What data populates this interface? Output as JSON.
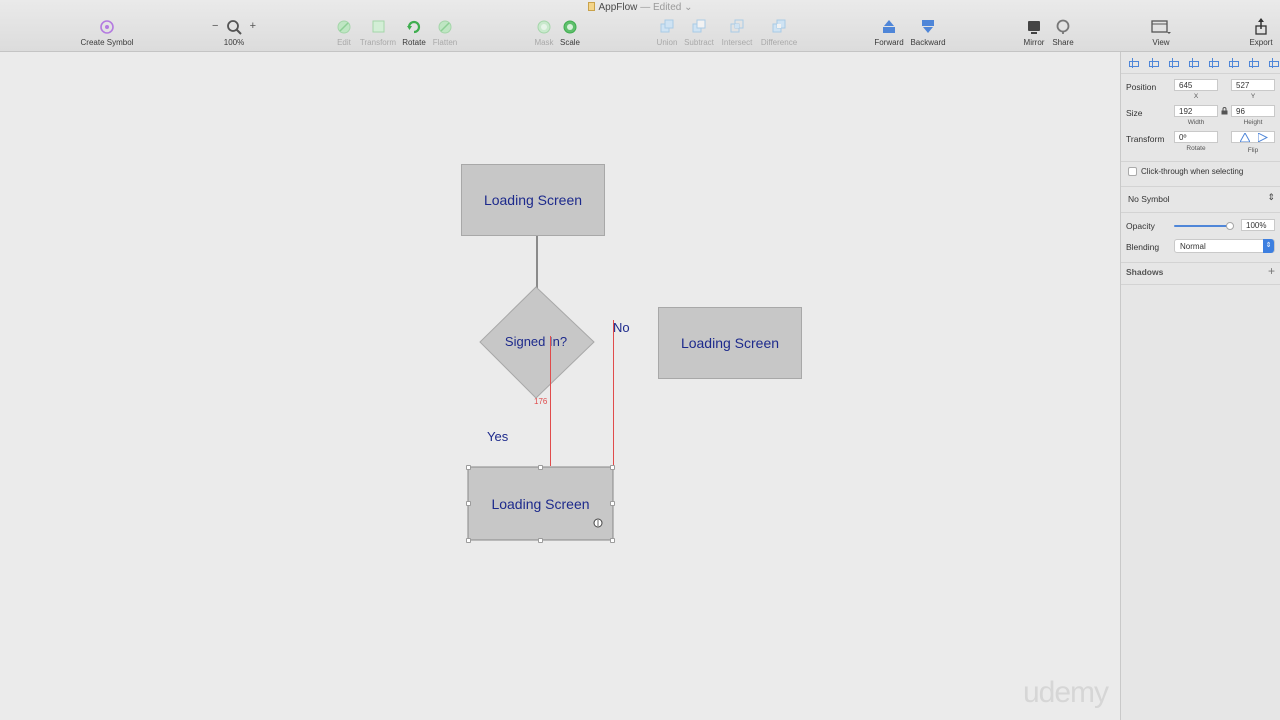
{
  "window": {
    "title": "AppFlow",
    "status": "— Edited",
    "chevron": "⌄"
  },
  "toolbar": {
    "create_symbol": "Create Symbol",
    "zoom_minus": "−",
    "zoom_plus": "+",
    "zoom_level": "100%",
    "edit": "Edit",
    "transform": "Transform",
    "rotate": "Rotate",
    "flatten": "Flatten",
    "mask": "Mask",
    "scale": "Scale",
    "union": "Union",
    "subtract": "Subtract",
    "intersect": "Intersect",
    "difference": "Difference",
    "forward": "Forward",
    "backward": "Backward",
    "mirror": "Mirror",
    "share": "Share",
    "view": "View",
    "export": "Export"
  },
  "canvas": {
    "box_top": "Loading Screen",
    "decision": "Signed In?",
    "label_no": "No",
    "label_yes": "Yes",
    "box_right": "Loading Screen",
    "box_bottom": "Loading Screen",
    "measurement": "176",
    "watermark": "udemy"
  },
  "inspector": {
    "position_label": "Position",
    "x_value": "645",
    "y_value": "527",
    "x_sub": "X",
    "y_sub": "Y",
    "size_label": "Size",
    "width_value": "192",
    "height_value": "96",
    "width_sub": "Width",
    "height_sub": "Height",
    "transform_label": "Transform",
    "rotate_value": "0º",
    "rotate_sub": "Rotate",
    "flip_sub": "Flip",
    "click_through": "Click-through when selecting",
    "symbol": "No Symbol",
    "opacity_label": "Opacity",
    "opacity_value": "100%",
    "opacity_level": 1.0,
    "blending_label": "Blending",
    "blending_value": "Normal",
    "shadows_label": "Shadows",
    "add_shadow": "+"
  },
  "colors": {
    "accent": "#3d7fe0",
    "guide": "#e04b4b",
    "label_text": "#1d2a8c",
    "shape_fill": "#c7c7c7"
  }
}
